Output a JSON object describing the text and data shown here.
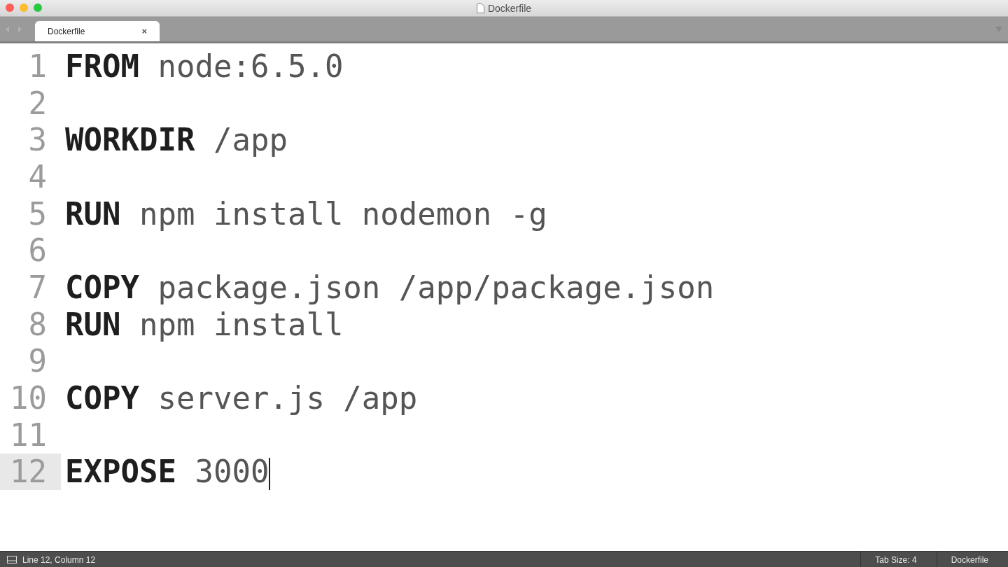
{
  "window": {
    "title": "Dockerfile"
  },
  "tabs": [
    {
      "label": "Dockerfile",
      "close": "×",
      "selected": true
    }
  ],
  "lines": [
    {
      "number": "1",
      "keyword": "FROM",
      "args": "node:6.5.0",
      "current": false
    },
    {
      "number": "2",
      "current": false
    },
    {
      "number": "3",
      "keyword": "WORKDIR",
      "args": "/app",
      "current": false
    },
    {
      "number": "4",
      "current": false
    },
    {
      "number": "5",
      "keyword": "RUN",
      "args": "npm install nodemon -g",
      "current": false
    },
    {
      "number": "6",
      "current": false
    },
    {
      "number": "7",
      "keyword": "COPY",
      "args": "package.json /app/package.json",
      "current": false
    },
    {
      "number": "8",
      "keyword": "RUN",
      "args": "npm install",
      "current": false
    },
    {
      "number": "9",
      "current": false
    },
    {
      "number": "10",
      "keyword": "COPY",
      "args": "server.js /app",
      "current": false
    },
    {
      "number": "11",
      "current": false
    },
    {
      "number": "12",
      "keyword": "EXPOSE",
      "args": "3000",
      "current": true
    }
  ],
  "status_bar": {
    "position": "Line 12, Column 12",
    "tab_size": "Tab Size: 4",
    "syntax": "Dockerfile"
  }
}
